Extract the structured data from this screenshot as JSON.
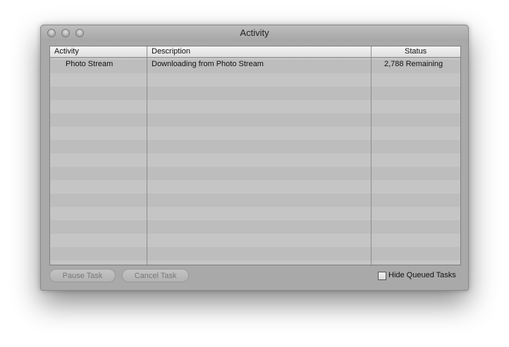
{
  "window": {
    "title": "Activity"
  },
  "table": {
    "headers": {
      "activity": "Activity",
      "description": "Description",
      "status": "Status"
    },
    "rows": [
      {
        "activity": "Photo Stream",
        "description": "Downloading from Photo Stream",
        "status": "2,788 Remaining"
      }
    ]
  },
  "buttons": {
    "pause": "Pause Task",
    "cancel": "Cancel Task"
  },
  "options": {
    "hide_queued_label": "Hide Queued Tasks",
    "hide_queued_checked": false
  }
}
